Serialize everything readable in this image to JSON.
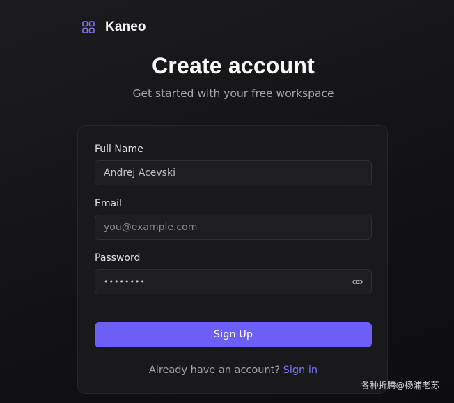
{
  "brand": {
    "name": "Kaneo",
    "icon": "grid-icon",
    "icon_color": "#7f74ff"
  },
  "heading": {
    "title": "Create account",
    "subtitle": "Get started with your free workspace"
  },
  "form": {
    "full_name": {
      "label": "Full Name",
      "value": "Andrej Acevski"
    },
    "email": {
      "label": "Email",
      "value": "",
      "placeholder": "you@example.com"
    },
    "password": {
      "label": "Password",
      "masked_value": "••••••••",
      "toggle_icon": "eye-icon"
    },
    "submit_label": "Sign Up",
    "signin_prompt": "Already have an account?",
    "signin_link": "Sign in"
  },
  "watermark": "各种折腾@杨浦老苏",
  "colors": {
    "accent": "#6c5ff5",
    "link": "#7e74ff",
    "background": "#141416",
    "card": "#19191c"
  }
}
